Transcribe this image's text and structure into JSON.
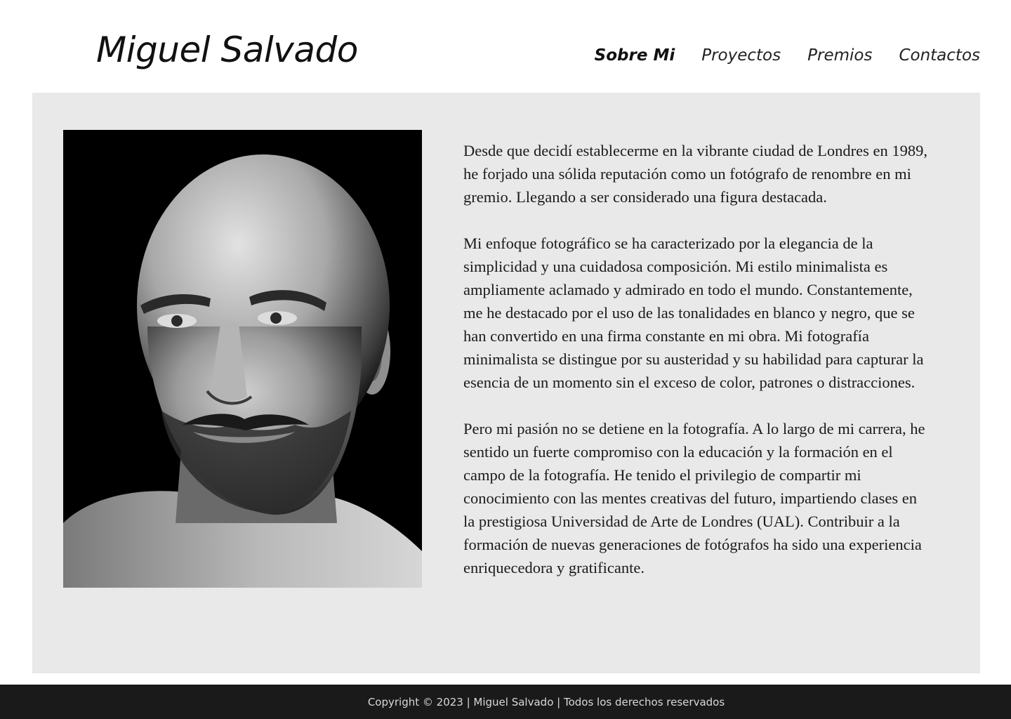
{
  "header": {
    "site_title": "Miguel Salvado",
    "nav": [
      {
        "label": "Sobre Mi",
        "active": true
      },
      {
        "label": "Proyectos",
        "active": false
      },
      {
        "label": "Premios",
        "active": false
      },
      {
        "label": "Contactos",
        "active": false
      }
    ]
  },
  "main": {
    "paragraphs": [
      "Desde que decidí establecerme en la vibrante ciudad de Londres en 1989, he forjado una sólida reputación como un fotógrafo de renombre en mi gremio. Llegando a ser considerado una figura destacada.",
      "Mi enfoque fotográfico se ha caracterizado por la elegancia de la simplicidad y una cuidadosa composición. Mi estilo minimalista es ampliamente aclamado y admirado en todo el mundo. Constantemente, me he destacado por el uso de las tonalidades en blanco y negro, que se han convertido en una firma constante en mi obra. Mi fotografía minimalista se distingue por su austeridad y su habilidad para capturar la esencia de un momento sin el exceso de color, patrones o distracciones.",
      "Pero mi pasión no se detiene en la fotografía. A lo largo de mi carrera, he sentido un fuerte compromiso con la educación y la formación en el campo de la fotografía. He tenido el privilegio de compartir mi conocimiento con las mentes creativas del futuro, impartiendo clases en la prestigiosa Universidad de Arte de Londres (UAL). Contribuir a la formación de nuevas generaciones de fotógrafos ha sido una experiencia enriquecedora y gratificante."
    ]
  },
  "footer": {
    "text": "Copyright © 2023 | Miguel Salvado | Todos los derechos reservados"
  },
  "colors": {
    "panel_background": "#e9e9e9",
    "footer_background": "#1a1a1a",
    "text": "#1a1a1a"
  }
}
